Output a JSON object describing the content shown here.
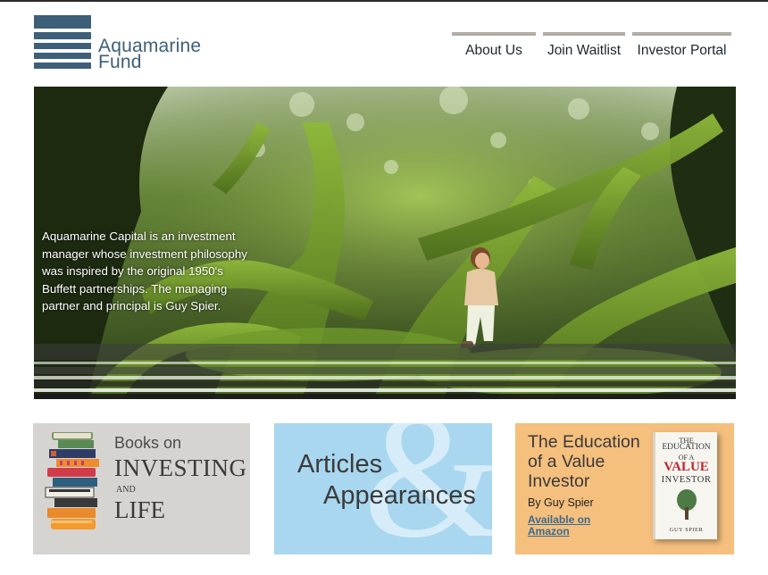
{
  "brand": {
    "name_line1": "Aquamarine",
    "name_line2": "Fund",
    "color": "#3d5f7a"
  },
  "nav": {
    "items": [
      {
        "label": "About Us"
      },
      {
        "label": "Join Waitlist"
      },
      {
        "label": "Investor Portal"
      }
    ],
    "rule_color": "#b1aca4"
  },
  "hero": {
    "text": "Aquamarine Capital is an investment manager whose investment philosophy was inspired by the original 1950's Buffett partnerships. The managing partner and principal is Guy Spier.",
    "scroll_hint": "v"
  },
  "cards": [
    {
      "name": "books",
      "line1": "Books on",
      "line2": "INVESTING",
      "line3": "AND",
      "line4": "LIFE",
      "bg": "#d6d4d1"
    },
    {
      "name": "articles",
      "line1": "Articles",
      "line2": "Appearances",
      "glyph": "&",
      "bg": "#a9d7ef"
    },
    {
      "name": "education",
      "title": "The Education of a Value Investor",
      "byline": "By Guy Spier",
      "link": "Available on Amazon",
      "book_cover": {
        "the": "THE",
        "education": "EDUCATION",
        "of_a": "OF A",
        "value": "VALUE",
        "investor": "INVESTOR",
        "author": "GUY SPIER"
      },
      "bg": "#f5bf7e"
    }
  ]
}
